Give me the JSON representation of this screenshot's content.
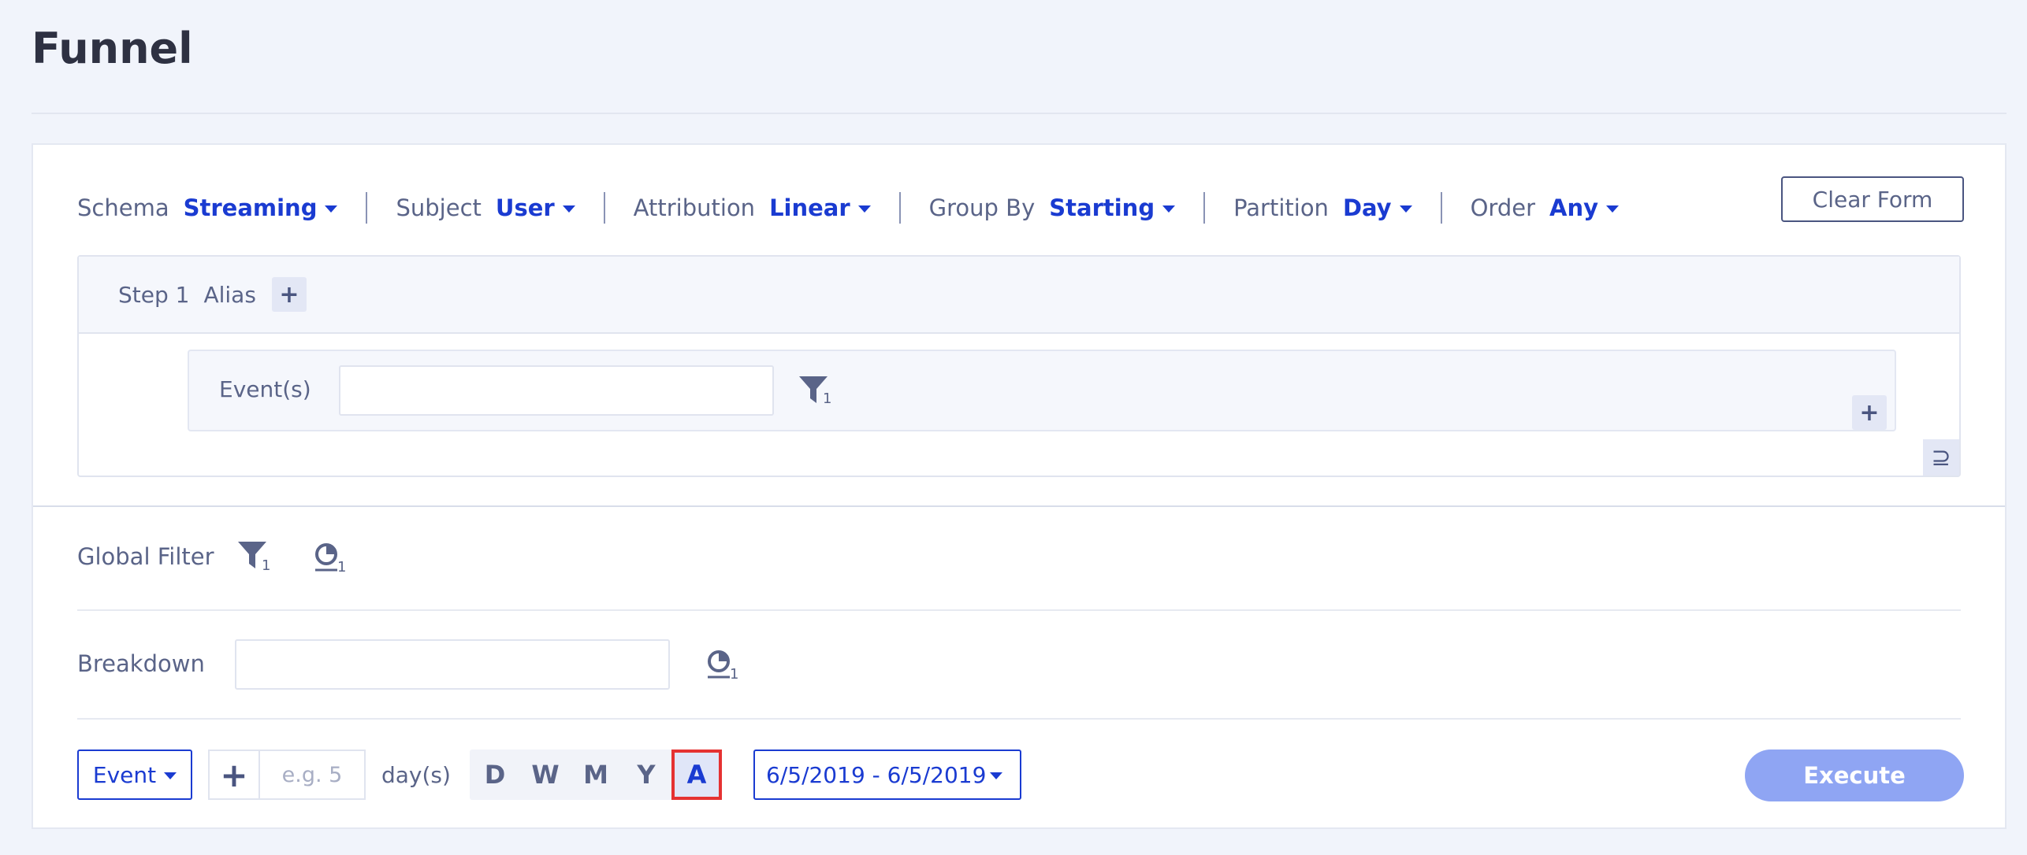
{
  "page": {
    "title": "Funnel"
  },
  "options": [
    {
      "label": "Schema",
      "value": "Streaming"
    },
    {
      "label": "Subject",
      "value": "User"
    },
    {
      "label": "Attribution",
      "value": "Linear"
    },
    {
      "label": "Group By",
      "value": "Starting"
    },
    {
      "label": "Partition",
      "value": "Day"
    },
    {
      "label": "Order",
      "value": "Any"
    }
  ],
  "clear_form_label": "Clear Form",
  "step": {
    "step_label": "Step 1",
    "alias_label": "Alias",
    "add_symbol": "+",
    "events_label": "Event(s)",
    "events_value": "",
    "filter_badge": "1",
    "superset_symbol": "⊇"
  },
  "global_filter": {
    "label": "Global Filter",
    "filter_badge": "1",
    "property_badge": "1"
  },
  "breakdown": {
    "label": "Breakdown",
    "value": "",
    "property_badge": "1"
  },
  "window": {
    "type_value": "Event",
    "stepper_symbol": "+",
    "count_placeholder": "e.g. 5",
    "unit_label": "day(s)",
    "periods": [
      "D",
      "W",
      "M",
      "Y",
      "A"
    ],
    "active_period": "A",
    "date_range": "6/5/2019 - 6/5/2019"
  },
  "execute_label": "Execute",
  "colors": {
    "accent": "#1a3bd1",
    "text_muted": "#5a6488",
    "execute_bg": "#8fa5f3",
    "highlight": "#e53232",
    "page_bg": "#f1f4fb"
  }
}
